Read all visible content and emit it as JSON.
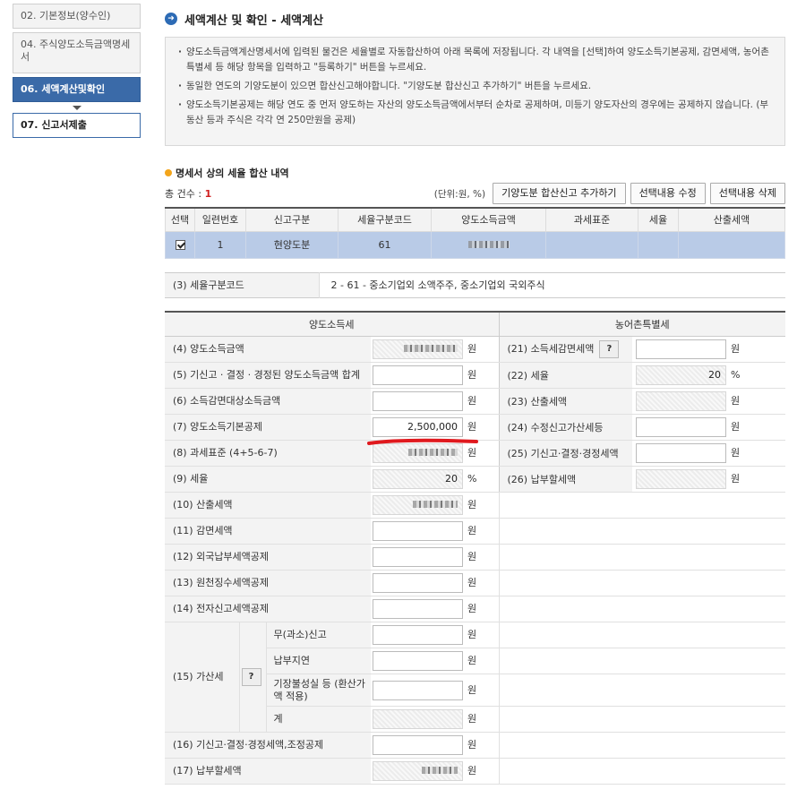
{
  "sidebar": {
    "items": [
      {
        "label": "02. 기본정보(양수인)"
      },
      {
        "label": "04. 주식양도소득금액명세서"
      },
      {
        "label": "06. 세액계산및확인"
      },
      {
        "label": "07. 신고서제출"
      }
    ]
  },
  "page": {
    "title": "세액계산 및 확인 - 세액계산",
    "title_icon": "arrow-right-circle-icon"
  },
  "notice": [
    "양도소득금액계산명세서에 입력된 물건은 세율별로 자동합산하여 아래 목록에 저장됩니다. 각 내역을 [선택]하여 양도소득기본공제, 감면세액, 농어촌특별세 등 해당 항목을 입력하고 \"등록하기\" 버튼을 누르세요.",
    "동일한 연도의 기양도분이 있으면 합산신고해야합니다. \"기양도분 합산신고 추가하기\" 버튼을 누르세요.",
    "양도소득기본공제는 해당 연도 중 먼저 양도하는 자산의 양도소득금액에서부터 순차로 공제하며, 미등기 양도자산의 경우에는 공제하지 않습니다. (부동산 등과 주식은 각각 연 250만원을 공제)"
  ],
  "summary": {
    "heading": "명세서 상의 세율 합산 내역",
    "count_label": "총 건수 : ",
    "count_value": "1",
    "unit_label": "(단위:원, %)",
    "buttons": {
      "add": "기양도분 합산신고 추가하기",
      "edit": "선택내용 수정",
      "delete": "선택내용 삭제"
    },
    "columns": [
      "선택",
      "일련번호",
      "신고구분",
      "세율구분코드",
      "양도소득금액",
      "과세표준",
      "세율",
      "산출세액"
    ],
    "rows": [
      {
        "serial": "1",
        "type": "현양도분",
        "code": "61",
        "amount": "",
        "tax_base": "",
        "rate": "",
        "computed": "",
        "checked": true
      }
    ]
  },
  "code_row": {
    "label": "(3) 세율구분코드",
    "value": "2 - 61 - 중소기업외 소액주주, 중소기업외 국외주식"
  },
  "calc": {
    "left_head": "양도소득세",
    "right_head": "농어촌특별세",
    "won": "원",
    "pct": "%",
    "help": "?",
    "rows": [
      {
        "label": "(4) 양도소득금액",
        "value": ""
      },
      {
        "label": "(5) 기신고 · 결정 · 경정된 양도소득금액 합계",
        "value": ""
      },
      {
        "label": "(6) 소득감면대상소득금액",
        "value": ""
      },
      {
        "label": "(7) 양도소득기본공제",
        "value": "2,500,000"
      },
      {
        "label": "(8) 과세표준 (4+5-6-7)",
        "value": ""
      },
      {
        "label": "(9) 세율",
        "value": "20"
      },
      {
        "label": "(10) 산출세액",
        "value": ""
      },
      {
        "label": "(11) 감면세액",
        "value": ""
      },
      {
        "label": "(12) 외국납부세액공제",
        "value": ""
      },
      {
        "label": "(13) 원천징수세액공제",
        "value": ""
      },
      {
        "label": "(14) 전자신고세액공제",
        "value": ""
      },
      {
        "label": "(15) 가산세",
        "value": ""
      },
      {
        "label": "(16) 기신고·결정·경정세액,조정공제",
        "value": ""
      },
      {
        "label": "(17) 납부할세액",
        "value": ""
      }
    ],
    "penalty_sub": [
      "무(과소)신고",
      "납부지연",
      "기장불성실 등 (환산가액 적용)",
      "계"
    ],
    "right_rows": [
      {
        "label": "(21) 소득세감면세액",
        "value": ""
      },
      {
        "label": "(22) 세율",
        "value": "20"
      },
      {
        "label": "(23) 산출세액",
        "value": ""
      },
      {
        "label": "(24) 수정신고가산세등",
        "value": ""
      },
      {
        "label": "(25) 기신고·결정·경정세액",
        "value": ""
      },
      {
        "label": "(26) 납부할세액",
        "value": ""
      }
    ]
  },
  "colors": {
    "accent": "#3a6aa8",
    "selected_row": "#b9cbe7",
    "annotation": "#e0191e"
  }
}
